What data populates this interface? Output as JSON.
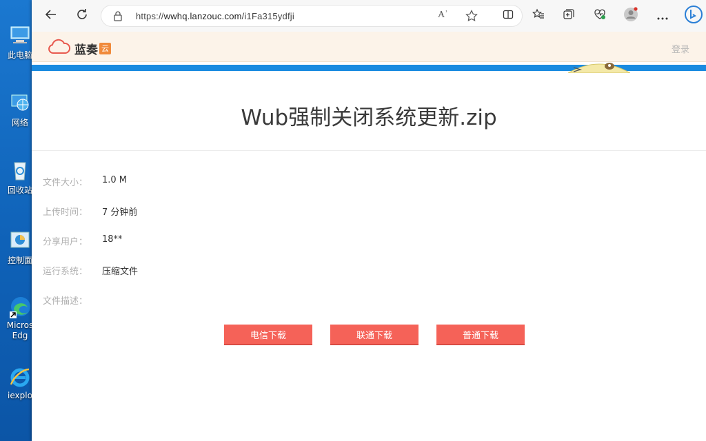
{
  "desktop": {
    "icons": [
      {
        "label": "此电脑"
      },
      {
        "label": "网络"
      },
      {
        "label": "回收站"
      },
      {
        "label": "控制面"
      },
      {
        "label": "Micros\nEdg"
      },
      {
        "label": "iexplo"
      }
    ]
  },
  "browser": {
    "url_prefix": "https://",
    "url_host": "wwhq.lanzouc.com",
    "url_path": "/i1Fa315ydfji",
    "read_aloud": "Aʾ"
  },
  "site": {
    "logo_text": "蓝奏",
    "logo_badge": "云",
    "login": "登录"
  },
  "file": {
    "title": "Wub强制关闭系统更新.zip",
    "rows": [
      {
        "key": "文件大小：",
        "value": "1.0 M"
      },
      {
        "key": "上传时间：",
        "value": "7 分钟前"
      },
      {
        "key": "分享用户：",
        "value": "18**"
      },
      {
        "key": "运行系统：",
        "value": "压缩文件"
      },
      {
        "key": "文件描述：",
        "value": ""
      }
    ]
  },
  "downloads": {
    "telecom": "电信下载",
    "unicom": "联通下载",
    "normal": "普通下载"
  },
  "colors": {
    "download_button": "#f56258",
    "site_header_bg": "#fcf3e9",
    "accent_strip": "#1a8be0"
  }
}
